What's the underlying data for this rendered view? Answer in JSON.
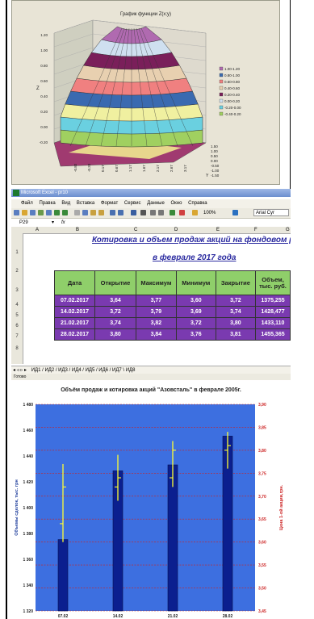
{
  "surface_chart": {
    "title": "График функции Z(x;y)",
    "z_ticks": [
      "1.20",
      "1.00",
      "0.80",
      "0.60",
      "0.40",
      "0.20",
      "0.00",
      "-0.20"
    ],
    "x_ticks": [
      "-0.83",
      "-0.33",
      "0.17",
      "0.67",
      "1.17",
      "1.67",
      "2.17",
      "2.67",
      "3.17"
    ],
    "y_ticks": [
      "1.50",
      "1.00",
      "0.50",
      "0.00",
      "-0.50",
      "-1.00",
      "-1.50"
    ],
    "legend": [
      "1.00-1.20",
      "0.80-1.00",
      "0.60-0.80",
      "0.40-0.60",
      "0.20-0.40",
      "0.00-0.20",
      "-0.20-0.00",
      "-0.40-0.20"
    ],
    "band_colors": [
      "#b06ab0",
      "#cfe0f0",
      "#7a1f5a",
      "#e8d0b0",
      "#f08080",
      "#3a6ab0",
      "#f0f0a0",
      "#6ad0e0",
      "#a0d060"
    ]
  },
  "excel": {
    "window_title": "Microsoft Excel - pr10",
    "menu": [
      "Файл",
      "Правка",
      "Вид",
      "Вставка",
      "Формат",
      "Сервис",
      "Данные",
      "Окно",
      "Справка"
    ],
    "zoom": "100%",
    "font_name": "Arial Cyr",
    "cell_ref": "P29",
    "columns": [
      "A",
      "B",
      "C",
      "D",
      "E",
      "F",
      "G"
    ],
    "rows": [
      "1",
      "2",
      "3",
      "4",
      "5",
      "6",
      "7",
      "8"
    ],
    "heading1": "Котировка и объем продаж акций на фондовом рынке",
    "heading2": "в феврале 2017 года",
    "table_headers": [
      "Дата",
      "Открытие",
      "Максимум",
      "Минимум",
      "Закрытие",
      "Объем, тыс. руб."
    ],
    "table_rows": [
      [
        "07.02.2017",
        "3,64",
        "3,77",
        "3,60",
        "3,72",
        "1375,255"
      ],
      [
        "14.02.2017",
        "3,72",
        "3,79",
        "3,69",
        "3,74",
        "1428,477"
      ],
      [
        "21.02.2017",
        "3,74",
        "3,82",
        "3,72",
        "3,80",
        "1433,110"
      ],
      [
        "28.02.2017",
        "3,80",
        "3,84",
        "3,76",
        "3,81",
        "1455,365"
      ]
    ],
    "sheet_tabs": "ИД1 / ИД2 / ИД3 / ИД4 / ИД5 / ИД6 / ИД7 \\ ИД8",
    "status": "Готово"
  },
  "chart_data": {
    "type": "bar",
    "title": "Объём продаж и котировка акций \"Азовсталь\" в феврале 2005г.",
    "categories": [
      "07.02",
      "14.02",
      "21.02",
      "28.02"
    ],
    "series": [
      {
        "name": "",
        "values": [
          1375.255,
          1428.477,
          1433.11,
          1455.365
        ]
      }
    ],
    "price_series": [
      {
        "high": 3.77,
        "low": 3.6,
        "open": 3.64,
        "close": 3.72
      },
      {
        "high": 3.79,
        "low": 3.69,
        "open": 3.72,
        "close": 3.74
      },
      {
        "high": 3.82,
        "low": 3.72,
        "open": 3.74,
        "close": 3.8
      },
      {
        "high": 3.84,
        "low": 3.76,
        "open": 3.8,
        "close": 3.81
      }
    ],
    "ylabel_left": "Объемы сделок, тыс. грн",
    "ylabel_right": "Цена 1-ой акции,грн.",
    "ylim_left": [
      1320,
      1480
    ],
    "ylim_right": [
      3.45,
      3.9
    ],
    "yticks_left": [
      "1 480",
      "1 460",
      "1 440",
      "1 420",
      "1 400",
      "1 380",
      "1 360",
      "1 340",
      "1 320"
    ],
    "yticks_right": [
      "3,90",
      "3,85",
      "3,80",
      "3,75",
      "3,70",
      "3,65",
      "3,60",
      "3,55",
      "3,50",
      "3,45"
    ],
    "colors": {
      "plot_bg": "#3d6fe0",
      "bar": "#0b1f8f",
      "price": "#ffff33",
      "grid": "#cc2222",
      "right_axis": "#cc2222"
    },
    "grid": true
  }
}
